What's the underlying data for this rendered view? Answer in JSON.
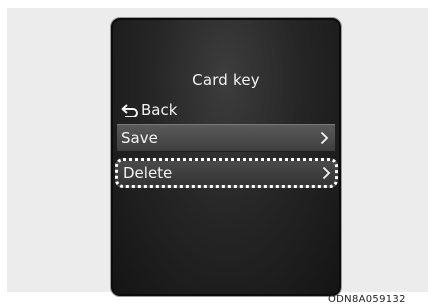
{
  "screen": {
    "title": "Card key",
    "back_label": "Back",
    "menu_items": [
      {
        "label": "Save",
        "icon": "chevron-right-icon"
      },
      {
        "label": "Delete",
        "icon": "chevron-right-icon",
        "highlighted": true
      }
    ]
  },
  "caption": "ODN8A059132",
  "colors": {
    "screen_background": "#262626",
    "text": "#f2f2f2",
    "highlight_outline": "#ffffff",
    "figure_background": "#ececec"
  }
}
